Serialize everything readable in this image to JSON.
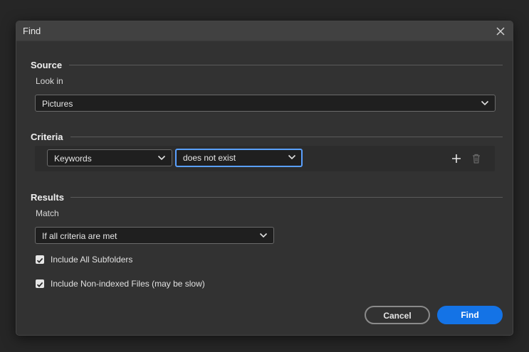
{
  "dialog": {
    "title": "Find"
  },
  "source": {
    "heading": "Source",
    "look_in_label": "Look in",
    "look_in_value": "Pictures"
  },
  "criteria": {
    "heading": "Criteria",
    "field_value": "Keywords",
    "condition_value": "does not exist"
  },
  "results": {
    "heading": "Results",
    "match_label": "Match",
    "match_value": "If all criteria are met",
    "include_subfolders_label": "Include All Subfolders",
    "include_subfolders_checked": true,
    "include_nonindexed_label": "Include Non-indexed Files (may be slow)",
    "include_nonindexed_checked": true
  },
  "buttons": {
    "cancel": "Cancel",
    "find": "Find"
  },
  "colors": {
    "accent": "#1473e6",
    "focus": "#5aa0ff",
    "surface": "#323232",
    "titlebar": "#414141"
  },
  "icons": [
    "close-icon",
    "chevron-down-icon",
    "plus-icon",
    "trash-icon",
    "checkmark-icon"
  ]
}
